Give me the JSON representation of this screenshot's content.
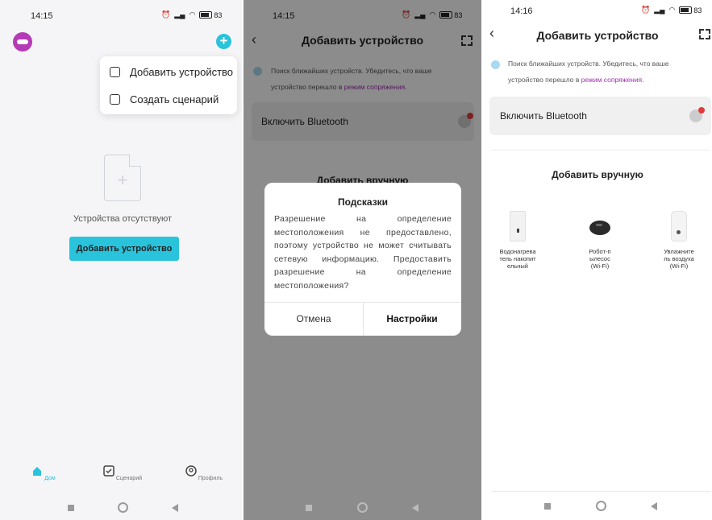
{
  "screen1": {
    "status": {
      "time": "14:15",
      "battery": "83"
    },
    "menu": {
      "add_device": "Добавить устройство",
      "create_scene": "Создать сценарий"
    },
    "empty_text": "Устройства отсутствуют",
    "add_button": "Добавить устройство",
    "tabs": [
      {
        "label": "Дом",
        "icon": "home-icon",
        "active": true
      },
      {
        "label": "Сценарий",
        "icon": "scene-icon",
        "active": false
      },
      {
        "label": "Профиль",
        "icon": "profile-icon",
        "active": false
      }
    ],
    "accent_color": "#29c3dc"
  },
  "screen2": {
    "status": {
      "time": "14:15",
      "battery": "83"
    },
    "title": "Добавить устройство",
    "hint_text": "Поиск ближайших устройств. Убедитесь, что ваше",
    "hint_text2": "устройство перешло в",
    "hint_link": "режим сопряжения",
    "hint_end": ".",
    "bluetooth_label": "Включить Bluetooth",
    "manual_title": "Добавить вручную",
    "dialog": {
      "title": "Подсказки",
      "message": "Разрешение на определение местоположения не предоставлено, поэтому устройство не может считывать сетевую информацию. Предоставить разрешение на определение местоположения?",
      "cancel": "Отмена",
      "settings": "Настройки"
    }
  },
  "screen3": {
    "status": {
      "time": "14:16",
      "battery": "83"
    },
    "title": "Добавить устройство",
    "hint_text": "Поиск ближайших устройств. Убедитесь, что ваше",
    "hint_text2": "устройство перешло в",
    "hint_link": "режим сопряжения",
    "hint_end": ".",
    "bluetooth_label": "Включить Bluetooth",
    "manual_title": "Добавить вручную",
    "devices": [
      {
        "line1": "Водонагрева",
        "line2": "тель накопит",
        "line3": "ельный"
      },
      {
        "line1": "Робот-п",
        "line2": "ылесос",
        "line3": "(Wi-Fi)"
      },
      {
        "line1": "Увлажните",
        "line2": "ль воздуха",
        "line3": "(Wi-Fi)"
      }
    ]
  }
}
